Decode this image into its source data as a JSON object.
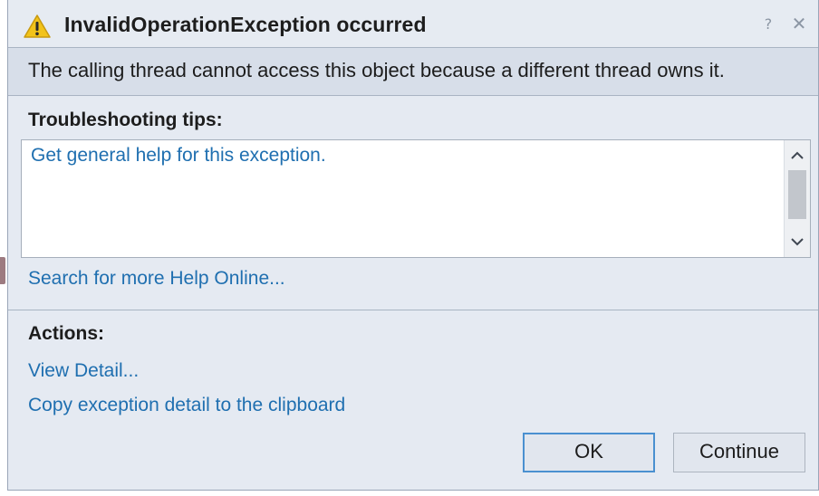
{
  "dialog": {
    "title": "InvalidOperationException occurred",
    "message": "The calling thread cannot access this object because a different thread owns it.",
    "title_buttons": {
      "help": "?",
      "close": "✕"
    }
  },
  "troubleshooting": {
    "label": "Troubleshooting tips:",
    "tips": [
      "Get general help for this exception."
    ],
    "search_link": "Search for more Help Online..."
  },
  "actions": {
    "label": "Actions:",
    "view_detail": "View Detail...",
    "copy_detail": "Copy exception detail to the clipboard"
  },
  "buttons": {
    "ok": "OK",
    "continue": "Continue"
  },
  "icons": {
    "title": "warning-icon",
    "scroll_up": "chevron-up-icon",
    "scroll_down": "chevron-down-icon"
  },
  "colors": {
    "link": "#1f6fb0",
    "warning": "#f2c31a",
    "ok_border": "#4a90d0"
  }
}
